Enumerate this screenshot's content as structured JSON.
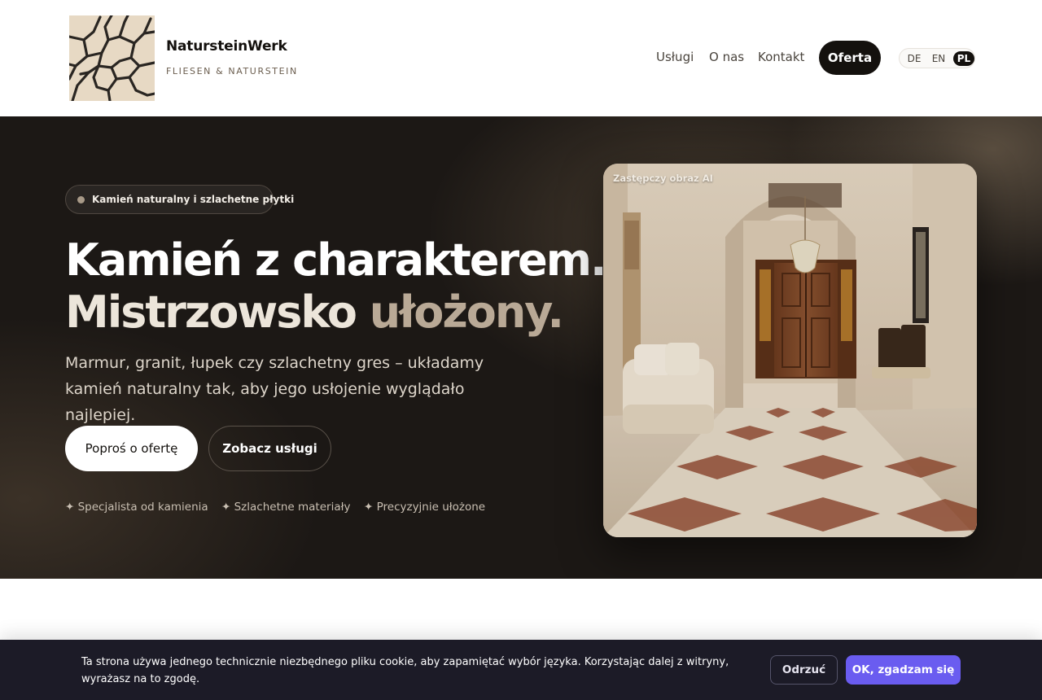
{
  "header": {
    "brand_name": "NatursteinWerk",
    "brand_sub": "FLIESEN & NATURSTEIN",
    "logo_icon": "cracked-stone-logo-icon",
    "nav": [
      {
        "label": "Usługi"
      },
      {
        "label": "O nas"
      },
      {
        "label": "Kontakt"
      }
    ],
    "cta_label": "Oferta",
    "languages": [
      "DE",
      "EN",
      "PL"
    ],
    "active_language": "PL"
  },
  "hero": {
    "badge": "Kamień naturalny i szlachetne płytki",
    "title_line1": "Kamień z charakterem.",
    "title_line2_main": "Mistrzowsko ",
    "title_line2_accent": "ułożony.",
    "lead": "Marmur, granit, łupek czy szlachetny gres – układamy kamień naturalny tak, aby jego usłojenie wyglądało najlepiej.",
    "primary_button": "Poproś o ofertę",
    "secondary_button": "Zobacz usługi",
    "features": [
      "✦ Specjalista od kamienia",
      "✦ Szlachetne materiały",
      "✦ Precyzyjnie ułożone"
    ],
    "image_caption": "Zastępczy obraz AI"
  },
  "cookie": {
    "text": "Ta strona używa jednego technicznie niezbędnego pliku cookie, aby zapamiętać wybór języka. Korzystając dalej z witryny, wyrażasz na to zgodę.",
    "reject_label": "Odrzuć",
    "accept_label": "OK, zgadzam się"
  },
  "colors": {
    "dark": "#14110e",
    "hero_bg": "#1c1815",
    "accent_text": "#b9a996",
    "cookie_bg": "#1c1b27",
    "accept_button": "#6a5cf0"
  }
}
